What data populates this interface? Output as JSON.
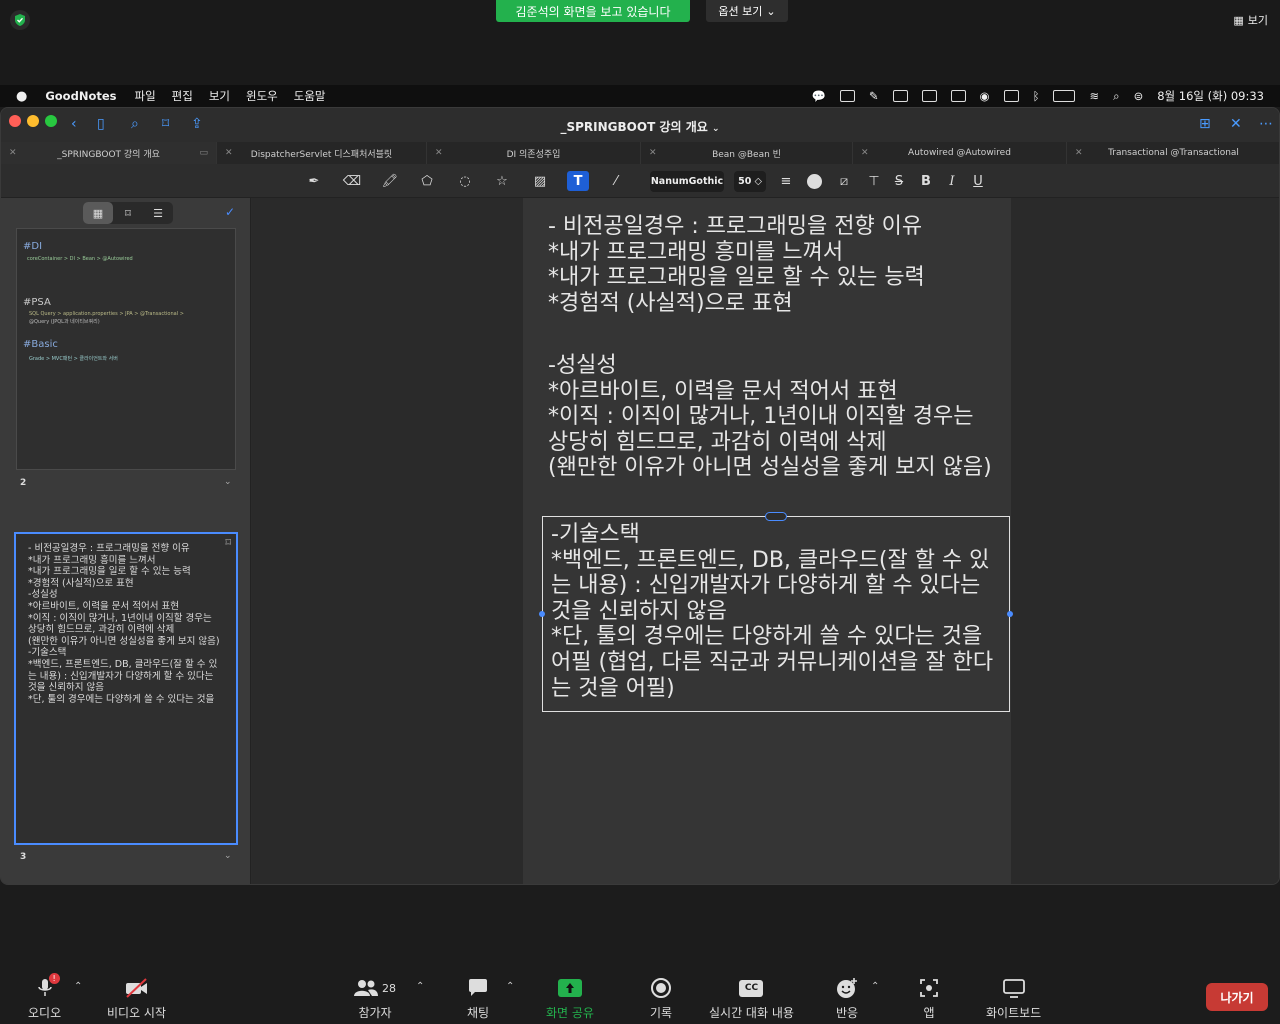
{
  "zoom_top": {
    "share_banner": "김준석의 화면을 보고 있습니다",
    "options_label": "옵션 보기",
    "view_label": "보기"
  },
  "menubar": {
    "app_name": "GoodNotes",
    "items": [
      "파일",
      "편집",
      "보기",
      "윈도우",
      "도움말"
    ],
    "datetime": "8월 16일 (화) 09:33"
  },
  "window": {
    "title": "_SPRINGBOOT 강의 개요",
    "tabs": [
      {
        "label": "_SPRINGBOOT 강의 개요"
      },
      {
        "label": "DispatcherServlet 디스패처서블릿"
      },
      {
        "label": "DI 의존성주입"
      },
      {
        "label": "Bean @Bean 빈"
      },
      {
        "label": "Autowired @Autowired"
      },
      {
        "label": "Transactional @Transactional"
      }
    ],
    "toolbar": {
      "font_name": "NanumGothic",
      "font_size": "50 ◇"
    }
  },
  "sidebar": {
    "thumb2": {
      "headings": [
        "#DI",
        "#PSA",
        "#Basic"
      ],
      "small_lines": [
        "coreContainer > DI > Bean > @Autowired",
        "SQL Query > application.properties > JPA > @Transactional >",
        "@Query (JPQL과 네이티브쿼리)",
        "Grade > MVC패턴 > 클라이언트와 서버"
      ],
      "page_number": "2"
    },
    "thumb3": {
      "lines": [
        "- 비전공일경우 : 프로그래밍을 전향 이유",
        "*내가 프로그래밍 흥미를 느껴서",
        "*내가 프로그래밍을 일로 할 수 있는 능력",
        "*경험적 (사실적)으로 표현",
        "",
        "-성실성",
        "*아르바이트, 이력을 문서 적어서 표현",
        "*이직 : 이직이 많거나, 1년이내 이직할 경우는",
        "상당히 힘드므로, 과감히 이력에 삭제",
        "(왠만한 이유가 아니면 성실성을 좋게 보지 않음)",
        "",
        "-기술스택",
        "*백엔드, 프론트엔드, DB, 클라우드(잘 할 수 있",
        "는 내용) : 신입개발자가 다양하게 할 수 있다는",
        "것을 신뢰하지 않음",
        "*단, 툴의 경우에는 다양하게 쓸 수 있다는 것을"
      ],
      "page_number": "3"
    }
  },
  "page": {
    "block1": [
      "- 비전공일경우 : 프로그래밍을 전향 이유",
      "*내가 프로그래밍 흥미를 느껴서",
      "*내가 프로그래밍을 일로 할 수 있는 능력",
      "*경험적 (사실적)으로 표현"
    ],
    "block2": [
      "-성실성",
      "*아르바이트, 이력을 문서 적어서 표현",
      "*이직 : 이직이 많거나, 1년이내 이직할 경우는",
      "상당히 힘드므로, 과감히 이력에 삭제",
      "(왠만한 이유가 아니면 성실성을 좋게 보지 않음)"
    ],
    "block3": [
      "-기술스택",
      "*백엔드, 프론트엔드, DB, 클라우드(잘 할 수 있",
      "는 내용) : 신입개발자가 다양하게 할 수 있다는",
      "것을 신뢰하지 않음",
      "*단, 툴의 경우에는 다양하게 쓸 수 있다는 것을",
      "어필 (협업, 다른 직군과 커뮤니케이션을 잘 한다",
      "는 것을 어필)"
    ]
  },
  "zoom_bottom": {
    "audio": "오디오",
    "video": "비디오 시작",
    "participants": "참가자",
    "participants_count": "28",
    "chat": "채팅",
    "share": "화면 공유",
    "record": "기록",
    "captions": "실시간 대화 내용",
    "reactions": "반응",
    "apps": "앱",
    "whiteboard": "화이트보드",
    "leave": "나가기"
  },
  "colors": {
    "share_green": "#23b14d",
    "accent_blue": "#4a8cff",
    "leave_red": "#c73a34"
  }
}
